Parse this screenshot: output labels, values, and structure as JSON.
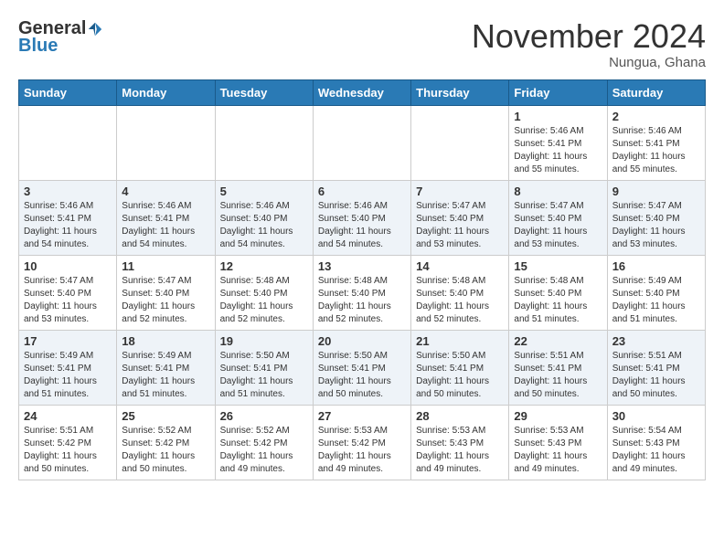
{
  "header": {
    "logo_general": "General",
    "logo_blue": "Blue",
    "month_title": "November 2024",
    "location": "Nungua, Ghana"
  },
  "days_of_week": [
    "Sunday",
    "Monday",
    "Tuesday",
    "Wednesday",
    "Thursday",
    "Friday",
    "Saturday"
  ],
  "weeks": [
    {
      "days": [
        {
          "num": "",
          "info": ""
        },
        {
          "num": "",
          "info": ""
        },
        {
          "num": "",
          "info": ""
        },
        {
          "num": "",
          "info": ""
        },
        {
          "num": "",
          "info": ""
        },
        {
          "num": "1",
          "info": "Sunrise: 5:46 AM\nSunset: 5:41 PM\nDaylight: 11 hours\nand 55 minutes."
        },
        {
          "num": "2",
          "info": "Sunrise: 5:46 AM\nSunset: 5:41 PM\nDaylight: 11 hours\nand 55 minutes."
        }
      ]
    },
    {
      "days": [
        {
          "num": "3",
          "info": "Sunrise: 5:46 AM\nSunset: 5:41 PM\nDaylight: 11 hours\nand 54 minutes."
        },
        {
          "num": "4",
          "info": "Sunrise: 5:46 AM\nSunset: 5:41 PM\nDaylight: 11 hours\nand 54 minutes."
        },
        {
          "num": "5",
          "info": "Sunrise: 5:46 AM\nSunset: 5:40 PM\nDaylight: 11 hours\nand 54 minutes."
        },
        {
          "num": "6",
          "info": "Sunrise: 5:46 AM\nSunset: 5:40 PM\nDaylight: 11 hours\nand 54 minutes."
        },
        {
          "num": "7",
          "info": "Sunrise: 5:47 AM\nSunset: 5:40 PM\nDaylight: 11 hours\nand 53 minutes."
        },
        {
          "num": "8",
          "info": "Sunrise: 5:47 AM\nSunset: 5:40 PM\nDaylight: 11 hours\nand 53 minutes."
        },
        {
          "num": "9",
          "info": "Sunrise: 5:47 AM\nSunset: 5:40 PM\nDaylight: 11 hours\nand 53 minutes."
        }
      ]
    },
    {
      "days": [
        {
          "num": "10",
          "info": "Sunrise: 5:47 AM\nSunset: 5:40 PM\nDaylight: 11 hours\nand 53 minutes."
        },
        {
          "num": "11",
          "info": "Sunrise: 5:47 AM\nSunset: 5:40 PM\nDaylight: 11 hours\nand 52 minutes."
        },
        {
          "num": "12",
          "info": "Sunrise: 5:48 AM\nSunset: 5:40 PM\nDaylight: 11 hours\nand 52 minutes."
        },
        {
          "num": "13",
          "info": "Sunrise: 5:48 AM\nSunset: 5:40 PM\nDaylight: 11 hours\nand 52 minutes."
        },
        {
          "num": "14",
          "info": "Sunrise: 5:48 AM\nSunset: 5:40 PM\nDaylight: 11 hours\nand 52 minutes."
        },
        {
          "num": "15",
          "info": "Sunrise: 5:48 AM\nSunset: 5:40 PM\nDaylight: 11 hours\nand 51 minutes."
        },
        {
          "num": "16",
          "info": "Sunrise: 5:49 AM\nSunset: 5:40 PM\nDaylight: 11 hours\nand 51 minutes."
        }
      ]
    },
    {
      "days": [
        {
          "num": "17",
          "info": "Sunrise: 5:49 AM\nSunset: 5:41 PM\nDaylight: 11 hours\nand 51 minutes."
        },
        {
          "num": "18",
          "info": "Sunrise: 5:49 AM\nSunset: 5:41 PM\nDaylight: 11 hours\nand 51 minutes."
        },
        {
          "num": "19",
          "info": "Sunrise: 5:50 AM\nSunset: 5:41 PM\nDaylight: 11 hours\nand 51 minutes."
        },
        {
          "num": "20",
          "info": "Sunrise: 5:50 AM\nSunset: 5:41 PM\nDaylight: 11 hours\nand 50 minutes."
        },
        {
          "num": "21",
          "info": "Sunrise: 5:50 AM\nSunset: 5:41 PM\nDaylight: 11 hours\nand 50 minutes."
        },
        {
          "num": "22",
          "info": "Sunrise: 5:51 AM\nSunset: 5:41 PM\nDaylight: 11 hours\nand 50 minutes."
        },
        {
          "num": "23",
          "info": "Sunrise: 5:51 AM\nSunset: 5:41 PM\nDaylight: 11 hours\nand 50 minutes."
        }
      ]
    },
    {
      "days": [
        {
          "num": "24",
          "info": "Sunrise: 5:51 AM\nSunset: 5:42 PM\nDaylight: 11 hours\nand 50 minutes."
        },
        {
          "num": "25",
          "info": "Sunrise: 5:52 AM\nSunset: 5:42 PM\nDaylight: 11 hours\nand 50 minutes."
        },
        {
          "num": "26",
          "info": "Sunrise: 5:52 AM\nSunset: 5:42 PM\nDaylight: 11 hours\nand 49 minutes."
        },
        {
          "num": "27",
          "info": "Sunrise: 5:53 AM\nSunset: 5:42 PM\nDaylight: 11 hours\nand 49 minutes."
        },
        {
          "num": "28",
          "info": "Sunrise: 5:53 AM\nSunset: 5:43 PM\nDaylight: 11 hours\nand 49 minutes."
        },
        {
          "num": "29",
          "info": "Sunrise: 5:53 AM\nSunset: 5:43 PM\nDaylight: 11 hours\nand 49 minutes."
        },
        {
          "num": "30",
          "info": "Sunrise: 5:54 AM\nSunset: 5:43 PM\nDaylight: 11 hours\nand 49 minutes."
        }
      ]
    }
  ]
}
